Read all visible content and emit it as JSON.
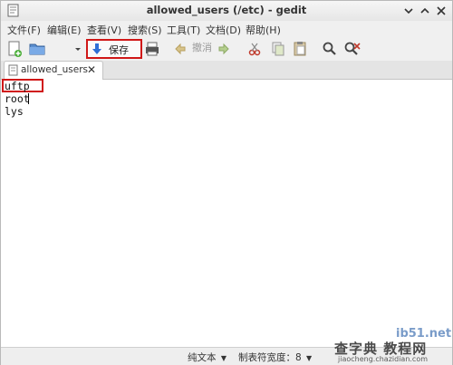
{
  "window": {
    "title": "allowed_users (/etc) - gedit"
  },
  "menubar": {
    "items": [
      "文件(F)",
      "编辑(E)",
      "查看(V)",
      "搜索(S)",
      "工具(T)",
      "文档(D)",
      "帮助(H)"
    ]
  },
  "toolbar": {
    "open_label": "打开",
    "save_label": "保存",
    "undo_label": "撤消"
  },
  "tabs": [
    {
      "label": "allowed_users"
    }
  ],
  "editor": {
    "lines": [
      "uftp",
      "root",
      "lys"
    ]
  },
  "statusbar": {
    "language": "纯文本",
    "tab_width": "制表符宽度：8"
  },
  "watermark": {
    "site": "ib51.net",
    "text": "查字典 教程网",
    "url": "jiaocheng.chazidian.com"
  },
  "colors": {
    "highlight_box": "#d01818",
    "save_icon": "#2f6fd6"
  }
}
